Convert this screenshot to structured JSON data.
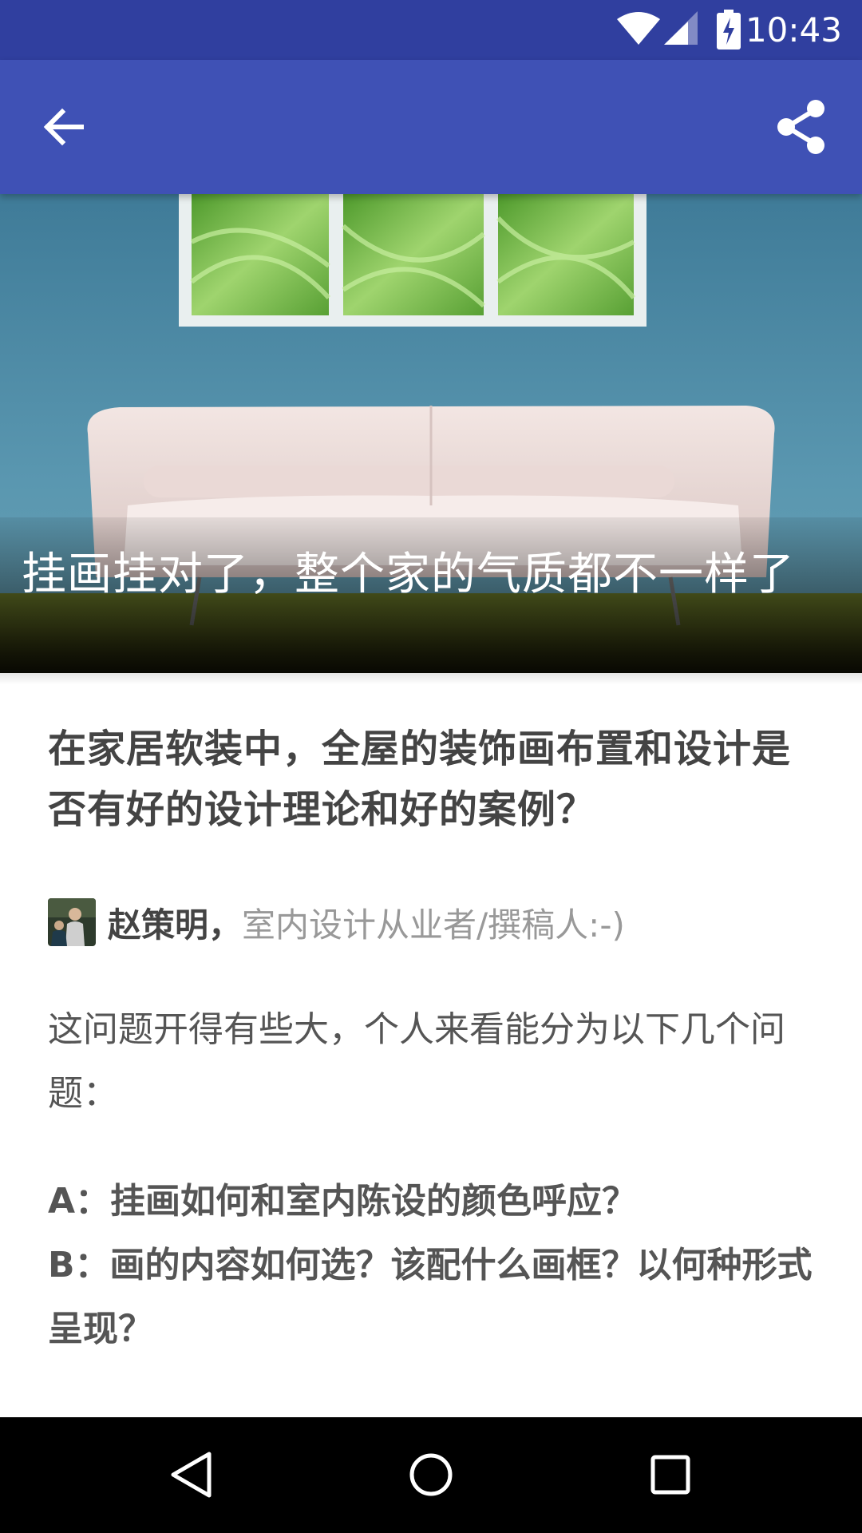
{
  "status_bar": {
    "time": "10:43",
    "wifi_icon": "wifi-icon",
    "signal_icon": "cell-signal-icon",
    "battery_icon": "battery-charging-icon"
  },
  "app_bar": {
    "back_icon": "arrow-back-icon",
    "share_icon": "share-icon",
    "background_color": "#3f51b5",
    "status_color": "#303f9f"
  },
  "hero": {
    "caption": "挂画挂对了，整个家的气质都不一样了"
  },
  "article": {
    "question_title": "在家居软装中，全屋的装饰画布置和设计是否有好的设计理论和好的案例？",
    "author": {
      "name": "赵策明，",
      "bio": "室内设计从业者/撰稿人:-)"
    },
    "intro": "这问题开得有些大，个人来看能分为以下几个问题：",
    "points": [
      "A：挂画如何和室内陈设的颜色呼应？",
      "B：画的内容如何选？该配什么画框？以何种形式呈现？"
    ]
  },
  "nav_bar": {
    "back": "nav-back-icon",
    "home": "nav-home-icon",
    "recents": "nav-recents-icon"
  }
}
